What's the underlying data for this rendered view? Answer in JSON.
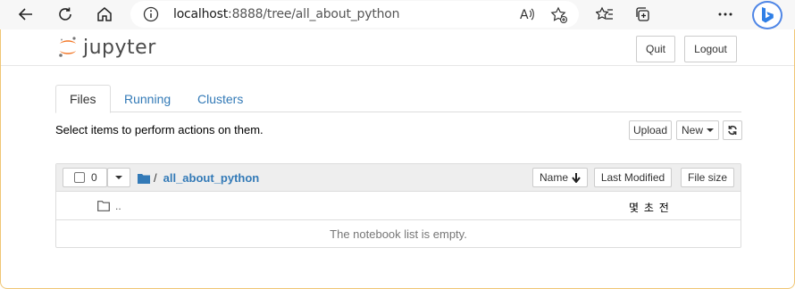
{
  "browser": {
    "url_host": "localhost",
    "url_rest": ":8888/tree/all_about_python",
    "icons": [
      "back-icon",
      "refresh-icon",
      "home-icon",
      "info-icon",
      "read-aloud-icon",
      "add-favorite-icon",
      "favorites-icon",
      "collections-icon",
      "more-icon",
      "bing-icon"
    ]
  },
  "header": {
    "logo_text": "jupyter",
    "quit_label": "Quit",
    "logout_label": "Logout"
  },
  "tabs": [
    {
      "label": "Files",
      "active": true
    },
    {
      "label": "Running",
      "active": false
    },
    {
      "label": "Clusters",
      "active": false
    }
  ],
  "toolbar": {
    "hint": "Select items to perform actions on them.",
    "upload_label": "Upload",
    "new_label": "New"
  },
  "list": {
    "selected_count": "0",
    "breadcrumb_sep": "/",
    "folder": "all_about_python",
    "sort_name": "Name",
    "sort_modified": "Last Modified",
    "sort_size": "File size",
    "updir_label": "..",
    "updir_modified": "몇 초 전",
    "empty_message": "The notebook list is empty."
  },
  "colors": {
    "accent": "#337ab7",
    "jupyter_orange": "#f37726",
    "frame": "#f0c674"
  }
}
